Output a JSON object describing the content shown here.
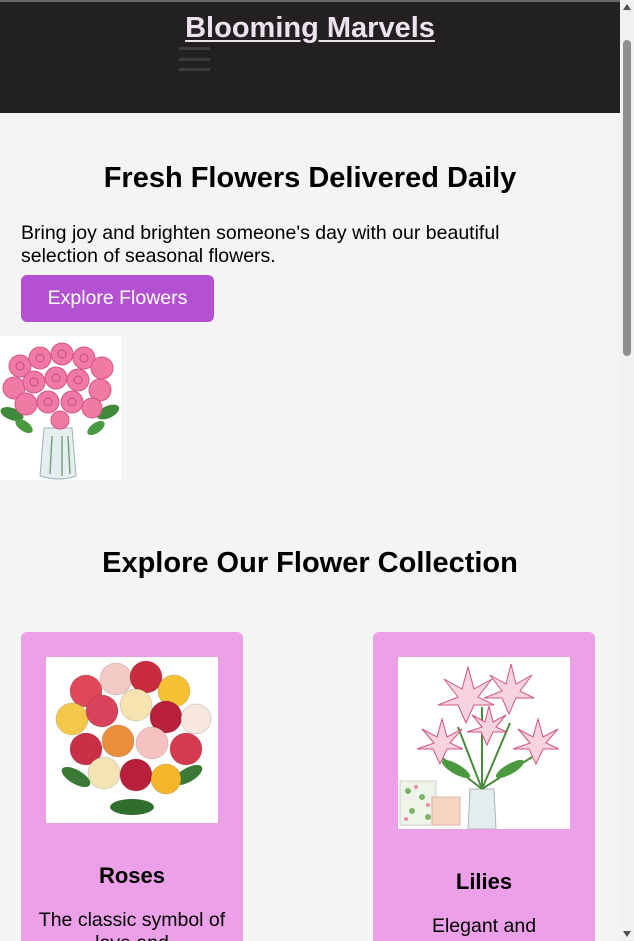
{
  "header": {
    "title": "Blooming Marvels"
  },
  "hero": {
    "title": "Fresh Flowers Delivered Daily",
    "text": "Bring joy and brighten someone's day with our beautiful selection of seasonal flowers.",
    "button_label": "Explore Flowers"
  },
  "collection": {
    "title": "Explore Our Flower Collection",
    "cards": [
      {
        "name": "Roses",
        "description": "The classic symbol of love and"
      },
      {
        "name": "Lilies",
        "description": "Elegant and"
      }
    ]
  },
  "colors": {
    "header_bg": "#232022",
    "accent_button": "#b451d2",
    "card_bg": "#eca0e8",
    "page_bg": "#f4f4f4"
  },
  "icons": {
    "menu": "hamburger-icon",
    "scroll_up": "arrow-up-icon",
    "scroll_down": "arrow-down-icon"
  }
}
